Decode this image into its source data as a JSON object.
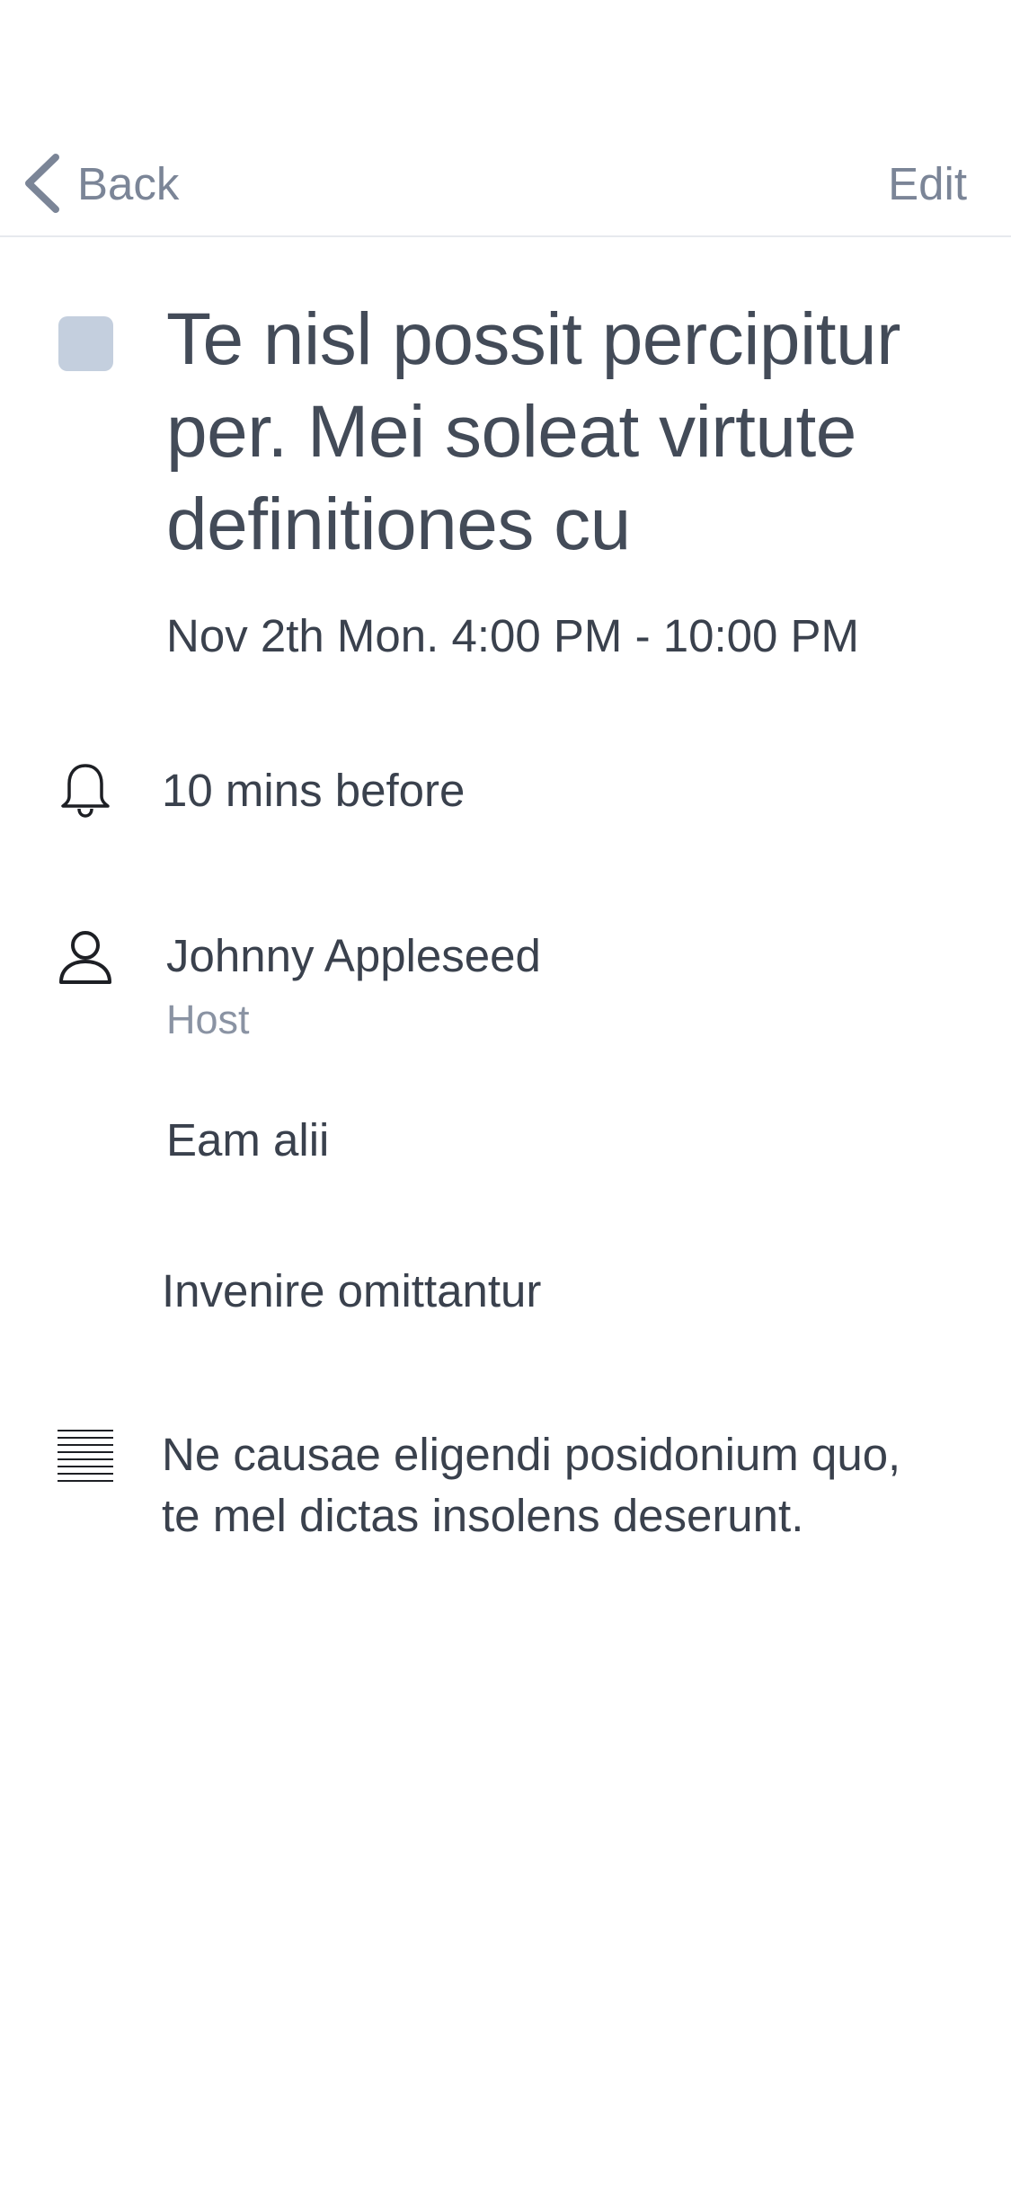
{
  "nav": {
    "back_label": "Back",
    "edit_label": "Edit"
  },
  "event": {
    "color": "#c4cfde",
    "title": "Te nisl possit percipitur per. Mei soleat virtute definitiones cu",
    "time": "Nov 2th Mon. 4:00 PM - 10:00 PM"
  },
  "reminder": {
    "icon": "bell-icon",
    "text": "10 mins before"
  },
  "attendee": {
    "icon": "person-icon",
    "name": "Johnny Appleseed",
    "role": "Host"
  },
  "calendar": {
    "text": "Eam alii"
  },
  "location": {
    "text": "Invenire omittantur"
  },
  "notes": {
    "icon": "notes-icon",
    "text": "Ne causae eligendi posidonium quo, te mel dictas insolens deserunt."
  },
  "colors": {
    "accent_muted": "#7b8597",
    "text_primary": "#3a414d",
    "text_secondary": "#8a93a3",
    "divider": "#e7e9ee"
  }
}
